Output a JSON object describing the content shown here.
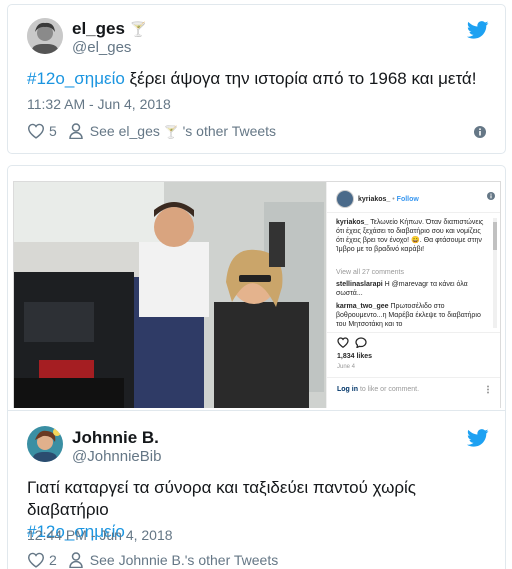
{
  "tweet1": {
    "display_name": "el_ges",
    "name_emoji": "🍸",
    "handle": "@el_ges",
    "hashtag": "#12ο_σημείο",
    "text": " ξέρει άψογα την ιστορία από το 1968 και μετά!",
    "timestamp": "11:32 AM - Jun 4, 2018",
    "likes": "5",
    "other_tweets_prefix": "See el_ges",
    "other_tweets_suffix": " 's other Tweets"
  },
  "instagram": {
    "username": "kyriakos_",
    "follow": "Follow",
    "caption_user": "kyriakos_",
    "caption": "Τελωνείο Κήπων. Όταν διαπιστώνεις ότι έχεις ξεχάσει το διαβατήριο σου και νομίζεις ότι έχεις βρει τον ένοχο! 😄. Θα φτάσουμε στην Ίμβρο με το βραδινό καράβι!",
    "view_all": "View all 27 comments",
    "comment1_user": "stellinaslarapi",
    "comment1": "Η @marevagr τα κάνει όλα σωστά...",
    "comment2_user": "karma_two_gee",
    "comment2": "Πρωτοσέλιδο στο βοθρουμεντο...η Μαρέβα έκλεψε το διαβατήριο του Μητσοτάκη και το",
    "likes": "1,834 likes",
    "date": "June 4",
    "login_text": "Log in",
    "login_suffix": " to like or comment."
  },
  "tweet2": {
    "display_name": "Johnnie B.",
    "handle": "@JohnnieBib",
    "text": "Γιατί καταργεί τα σύνορα και ταξιδεύει παντού χωρίς διαβατήριο",
    "hashtag": "#12ο_σημείο",
    "timestamp": "12:44 PM - Jun 4, 2018",
    "likes": "2",
    "other_tweets": "See Johnnie B.'s other Tweets"
  },
  "colors": {
    "twitter_blue": "#1da1f2",
    "link_blue": "#1b95e0",
    "gray_text": "#657786",
    "border": "#e1e8ed"
  },
  "icons": [
    "twitter-bird-icon",
    "heart-icon",
    "person-icon",
    "info-icon",
    "cocktail-icon"
  ]
}
